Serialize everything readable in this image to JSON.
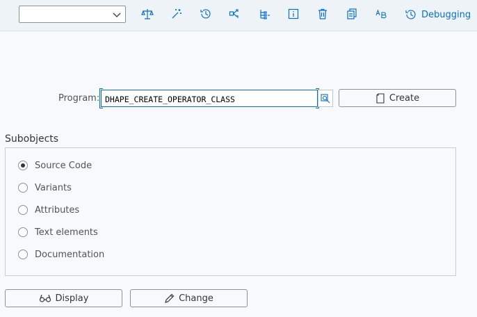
{
  "toolbar": {
    "dropdown_value": "",
    "icons": [
      "balance-icon",
      "magic-wand-icon",
      "history-icon",
      "hierarchy-icon",
      "tree-icon",
      "info-icon",
      "delete-icon",
      "copy-icon",
      "translate-icon"
    ],
    "debugging_label": "Debugging"
  },
  "program": {
    "label": "Program:",
    "value": "DHAPE_CREATE_OPERATOR_CLASS",
    "create_label": "Create"
  },
  "subobjects": {
    "title": "Subobjects",
    "options": [
      {
        "label": "Source Code",
        "checked": true
      },
      {
        "label": "Variants",
        "checked": false
      },
      {
        "label": "Attributes",
        "checked": false
      },
      {
        "label": "Text elements",
        "checked": false
      },
      {
        "label": "Documentation",
        "checked": false
      }
    ]
  },
  "actions": {
    "display_label": "Display",
    "change_label": "Change"
  },
  "colors": {
    "accent": "#0a6ed1",
    "background": "#f7f9fb"
  }
}
